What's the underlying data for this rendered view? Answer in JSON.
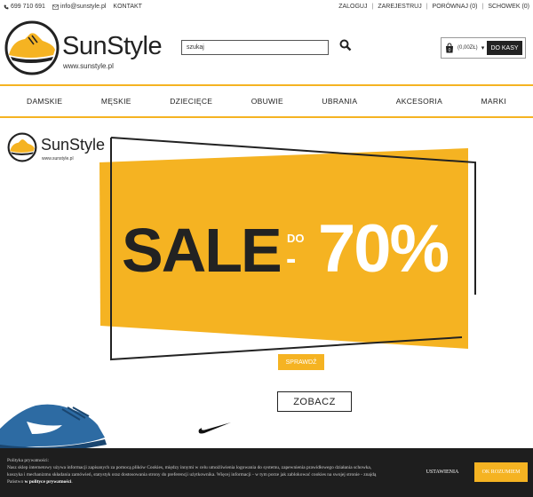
{
  "topbar": {
    "phone": "699 710 691",
    "email": "info@sunstyle.pl",
    "contact": "KONTAKT",
    "login": "ZALOGUJ",
    "register": "ZAREJESTRUJ",
    "compare": "PORÓWNAJ (0)",
    "wishlist": "SCHOWEK (0)"
  },
  "header": {
    "logo_text": "SunStyle",
    "logo_url": "www.sunstyle.pl",
    "search_value": "szukaj",
    "cart_count": "0",
    "cart_amount": "(0,00ZŁ)",
    "checkout_label": "DO KASY"
  },
  "nav": {
    "items": [
      "DAMSKIE",
      "MĘSKIE",
      "DZIECIĘCE",
      "OBUWIE",
      "UBRANIA",
      "AKCESORIA",
      "MARKI"
    ]
  },
  "banner": {
    "logo_text": "SunStyle",
    "logo_url": "www.sunstyle.pl",
    "sale": "SALE",
    "do": "DO",
    "dash": "-",
    "percent": "70%",
    "check_label": "SPRAWDŹ",
    "see_label": "ZOBACZ"
  },
  "cookie": {
    "title": "Polityka prywatności:",
    "body": "Nasz sklep internetowy używa informacji zapisanych za pomocą plików Cookies, między innymi w celu umożliwienia logowania do systemu, zapewnienia prawidłowego działania schowka, koszyka i mechanizmu składania zamówień, statystyk oraz dostosowania strony do preferencji użytkownika. Więcej informacji - w tym porze jak zablokować cookies na swojej stronie - znajdą Państwo",
    "link": "w polityce prywatności",
    "settings_label": "USTAWIENIA",
    "accept_label": "OK ROZUMIEM"
  },
  "colors": {
    "accent": "#f5b322",
    "dark": "#222222",
    "cookie_bg": "#1e1e1e"
  },
  "icons": [
    "phone-icon",
    "mail-icon",
    "search-icon",
    "bag-icon",
    "chevron-down-icon",
    "nike-swoosh-icon"
  ]
}
